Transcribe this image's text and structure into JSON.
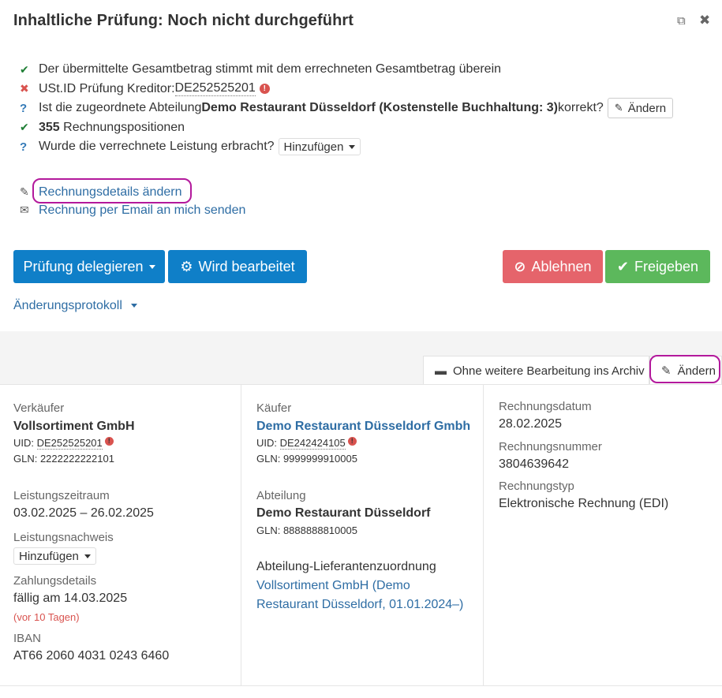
{
  "header": {
    "title": "Inhaltliche Prüfung: Noch nicht durchgeführt",
    "restore_icon": "⧉",
    "close_icon": "✖"
  },
  "checks": {
    "row1": "Der übermittelte Gesamtbetrag stimmt mit dem errechneten Gesamtbetrag überein",
    "row2_text": "USt.ID Prüfung Kreditor: ",
    "row2_id": "DE252525201",
    "row3_pre": "Ist die zugeordnete Abteilung ",
    "row3_bold": "Demo Restaurant Düsseldorf (Kostenstelle Buchhaltung: 3)",
    "row3_post": " korrekt?",
    "row3_button": "Ändern",
    "row4_count": "355",
    "row4_text": " Rechnungspositionen",
    "row5_text": "Wurde die verrechnete Leistung erbracht?",
    "row5_dropdown": "Hinzufügen"
  },
  "links": {
    "edit_details": "Rechnungsdetails ändern",
    "send_email": "Rechnung per Email an mich senden"
  },
  "actions": {
    "delegate": "Prüfung delegieren",
    "in_progress": "Wird bearbeitet",
    "reject": "Ablehnen",
    "approve": "Freigeben",
    "protocol": "Änderungsprotokoll"
  },
  "tabs": {
    "archive": "Ohne weitere Bearbeitung ins Archiv",
    "edit": "Ändern"
  },
  "seller": {
    "label": "Verkäufer",
    "name": "Vollsortiment GmbH",
    "uid_label": "UID: ",
    "uid": "DE252525201",
    "gln": "GLN: 2222222222101",
    "period_label": "Leistungszeitraum",
    "period": "03.02.2025 – 26.02.2025",
    "proof_label": "Leistungsnachweis",
    "proof_dropdown": "Hinzufügen",
    "payment_label": "Zahlungsdetails",
    "payment_due": "fällig am 14.03.2025",
    "payment_overdue": "(vor 10 Tagen)",
    "iban_label": "IBAN",
    "iban": "AT66 2060 4031 0243 6460"
  },
  "buyer": {
    "label": "Käufer",
    "name": "Demo Restaurant Düsseldorf Gmbh",
    "uid_label": "UID: ",
    "uid": "DE242424105",
    "gln": "GLN: 9999999910005",
    "dept_label": "Abteilung",
    "dept": "Demo Restaurant Düsseldorf",
    "dept_gln": "GLN: 8888888810005",
    "assign_label": "Abteilung-Lieferantenzuordnung",
    "assign_line1": "Vollsortiment GmbH (Demo",
    "assign_line2": "Restaurant Düsseldorf, 01.01.2024–)"
  },
  "invoice": {
    "date_label": "Rechnungsdatum",
    "date": "28.02.2025",
    "number_label": "Rechnungsnummer",
    "number": "3804639642",
    "type_label": "Rechnungstyp",
    "type": "Elektronische Rechnung (EDI)"
  },
  "colors": {
    "primary": "#0f7fc8",
    "danger": "#e5646b",
    "success": "#5cb85c",
    "link": "#2e6da4",
    "highlight": "#b3199c"
  }
}
